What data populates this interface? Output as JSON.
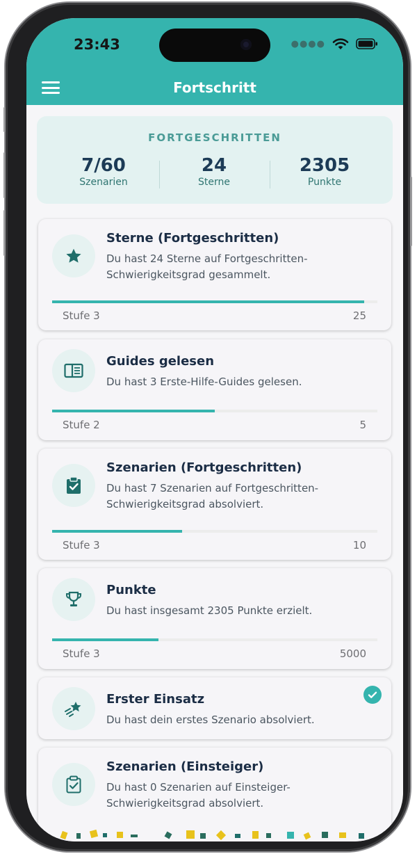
{
  "status_bar": {
    "time": "23:43"
  },
  "header": {
    "title": "Fortschritt",
    "menu_icon": "hamburger-menu-icon"
  },
  "summary": {
    "level": "FORTGESCHRITTEN",
    "stats": [
      {
        "value": "7/60",
        "label": "Szenarien"
      },
      {
        "value": "24",
        "label": "Sterne"
      },
      {
        "value": "2305",
        "label": "Punkte"
      }
    ]
  },
  "achievements": [
    {
      "icon": "star-icon",
      "title": "Sterne (Fortgeschritten)",
      "description": "Du hast 24 Sterne auf Fortgeschritten-Schwierigkeitsgrad gesammelt.",
      "stage": "Stufe 3",
      "goal": "25",
      "progress": 0.96
    },
    {
      "icon": "book-icon",
      "title": "Guides gelesen",
      "description": "Du hast 3 Erste-Hilfe-Guides gelesen.",
      "stage": "Stufe 2",
      "goal": "5",
      "progress": 0.5
    },
    {
      "icon": "clipboard-check-icon",
      "title": "Szenarien (Fortgeschritten)",
      "description": "Du hast 7 Szenarien auf Fortgeschritten-Schwierigkeitsgrad absolviert.",
      "stage": "Stufe 3",
      "goal": "10",
      "progress": 0.4
    },
    {
      "icon": "trophy-icon",
      "title": "Punkte",
      "description": "Du hast insgesamt 2305 Punkte erzielt.",
      "stage": "Stufe 3",
      "goal": "5000",
      "progress": 0.326
    },
    {
      "icon": "shooting-star-icon",
      "title": "Erster Einsatz",
      "description": "Du hast dein erstes Szenario absolviert.",
      "completed": true
    },
    {
      "icon": "clipboard-check-icon",
      "title": "Szenarien (Einsteiger)",
      "description": "Du hast 0 Szenarien auf Einsteiger-Schwierigkeitsgrad absolviert."
    }
  ],
  "colors": {
    "accent": "#35b4ae",
    "header": "#35b4ae",
    "icon": "#1f6e6a",
    "title_text": "#1b2d45"
  }
}
